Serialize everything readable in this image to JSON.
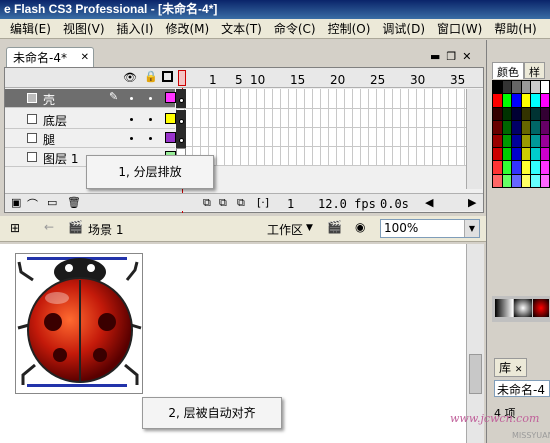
{
  "window": {
    "title": "e Flash CS3 Professional - [未命名-4*]"
  },
  "menubar": {
    "items": [
      "编辑(E)",
      "视图(V)",
      "插入(I)",
      "修改(M)",
      "文本(T)",
      "命令(C)",
      "控制(O)",
      "调试(D)",
      "窗口(W)",
      "帮助(H)"
    ]
  },
  "document": {
    "tab_label": "未命名-4*"
  },
  "timeline": {
    "ruler_numbers": [
      "1",
      "5",
      "10",
      "15",
      "20",
      "25",
      "30",
      "35"
    ],
    "layers": [
      {
        "name": "壳",
        "color": "#ff33ff",
        "selected": true
      },
      {
        "name": "底层",
        "color": "#ffff00",
        "selected": false
      },
      {
        "name": "腿",
        "color": "#9933cc",
        "selected": false
      },
      {
        "name": "图层 1",
        "color": "#99ee99",
        "selected": false
      }
    ],
    "current_frame": "1",
    "fps": "12.0 fps",
    "elapsed": "0.0s"
  },
  "callouts": {
    "layers_note": "1, 分层排放",
    "align_note": "2, 层被自动对齐"
  },
  "editbar": {
    "scene": "场景 1",
    "workspace": "工作区",
    "zoom": "100%"
  },
  "right_panel": {
    "color_tabs": [
      "颜色",
      "样"
    ],
    "library_tab": "库",
    "library_doc": "未命名-4",
    "library_count": "4 项"
  },
  "watermark": {
    "text": "www.jcwcn.com",
    "sub": "MISSYUAN.COM"
  },
  "colors": {
    "selected_layer_bg": "#6e6e6e",
    "playhead": "#cc0000",
    "title_bar": "#0a246a"
  }
}
